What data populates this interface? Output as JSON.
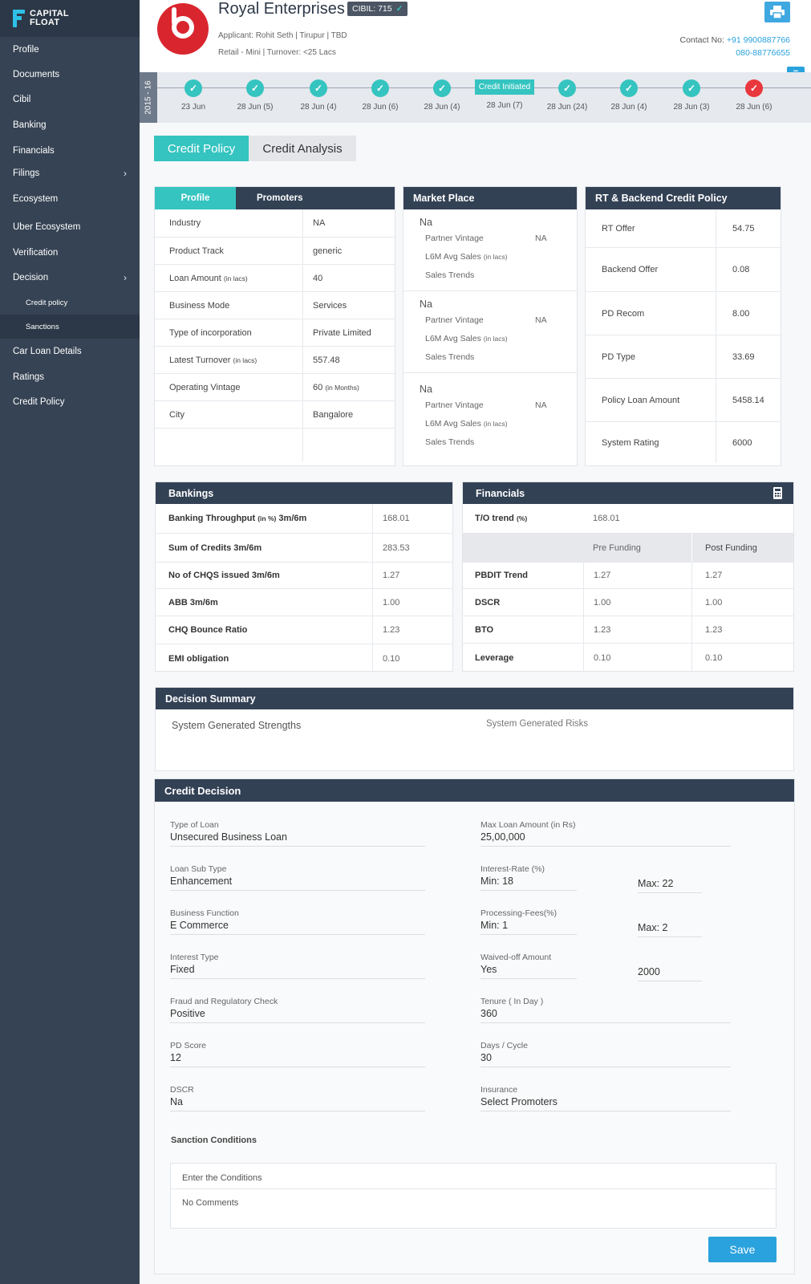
{
  "brand": {
    "line1": "CAPITAL",
    "line2": "FLOAT"
  },
  "sidebar": {
    "items": [
      {
        "label": "Profile"
      },
      {
        "label": "Documents"
      },
      {
        "label": "Cibil"
      },
      {
        "label": "Banking"
      },
      {
        "label": "Financials"
      },
      {
        "label": "Filings",
        "chevron": "›"
      },
      {
        "label": "Ecosystem"
      },
      {
        "label": "Uber Ecosystem"
      },
      {
        "label": "Verification"
      },
      {
        "label": "Decision",
        "chevron": "›"
      },
      {
        "label": "Credit policy"
      },
      {
        "label": "Sanctions"
      },
      {
        "label": "Car Loan Details"
      },
      {
        "label": "Ratings"
      },
      {
        "label": "Credit Policy"
      }
    ]
  },
  "header": {
    "company": "Royal Enterprises",
    "cibil": "CIBIL: 715",
    "cibil_check": "✓",
    "applicant": "Applicant: Rohit Seth | Tirupur | TBD",
    "segment": "Retail - Mini | Turnover: <25 Lacs",
    "contact_label": "Contact No:",
    "phone1": "+91 9900887766",
    "phone2": "080-88776655"
  },
  "timeline": {
    "year": "2015 - 16",
    "collapse": "−",
    "steps": [
      {
        "label": "23 Jun",
        "check": "✓"
      },
      {
        "label": "28 Jun (5)",
        "check": "✓"
      },
      {
        "label": "28 Jun (4)",
        "check": "✓"
      },
      {
        "label": "28 Jun (6)",
        "check": "✓"
      },
      {
        "label": "28 Jun (4)",
        "check": "✓"
      },
      {
        "label": "28 Jun (7)",
        "badge": "Credit Initiated"
      },
      {
        "label": "28 Jun (24)",
        "check": "✓"
      },
      {
        "label": "28 Jun (4)",
        "check": "✓"
      },
      {
        "label": "28 Jun (3)",
        "check": "✓"
      },
      {
        "label": "28 Jun (6)",
        "check": "✓",
        "status": "red"
      }
    ]
  },
  "tabs": {
    "credit_policy": "Credit Policy",
    "credit_analysis": "Credit Analysis"
  },
  "profile": {
    "tab_profile": "Profile",
    "tab_promoters": "Promoters",
    "rows": [
      {
        "k": "Industry",
        "v": "NA"
      },
      {
        "k": "Product Track",
        "v": "generic"
      },
      {
        "k": "Loan Amount",
        "ks": "(in lacs)",
        "v": "40"
      },
      {
        "k": "Business Mode",
        "v": "Services"
      },
      {
        "k": "Type of incorporation",
        "v": "Private Limited"
      },
      {
        "k": "Latest Turnover",
        "ks": "(in lacs)",
        "v": "557.48"
      },
      {
        "k": "Operating Vintage",
        "v": "60",
        "vs": "(in Months)"
      },
      {
        "k": "City",
        "v": "Bangalore"
      }
    ]
  },
  "market": {
    "title": "Market Place",
    "groups": [
      {
        "head": "Na",
        "vintage_label": "Partner Vintage",
        "vintage": "NA",
        "sales_label": "L6M Avg Sales",
        "sales_unit": "(in lacs)",
        "trends": "Sales Trends"
      },
      {
        "head": "Na",
        "vintage_label": "Partner Vintage",
        "vintage": "NA",
        "sales_label": "L6M Avg Sales",
        "sales_unit": "(in lacs)",
        "trends": "Sales Trends"
      },
      {
        "head": "Na",
        "vintage_label": "Partner Vintage",
        "vintage": "NA",
        "sales_label": "L6M Avg Sales",
        "sales_unit": "(in lacs)",
        "trends": "Sales Trends"
      }
    ]
  },
  "rt": {
    "title": "RT & Backend Credit Policy",
    "rows": [
      {
        "k": "RT Offer",
        "v": "54.75"
      },
      {
        "k": "Backend Offer",
        "v": "0.08"
      },
      {
        "k": "PD Recom",
        "v": "8.00"
      },
      {
        "k": "PD Type",
        "v": "33.69"
      },
      {
        "k": "Policy Loan Amount",
        "v": "5458.14"
      },
      {
        "k": "System Rating",
        "v": "6000"
      }
    ]
  },
  "bankings": {
    "title": "Bankings",
    "rows": [
      {
        "k": "Banking Throughput",
        "ks": "(in %)",
        "k2": "3m/6m",
        "v": "168.01"
      },
      {
        "k": "Sum of Credits 3m/6m",
        "v": "283.53"
      },
      {
        "k": "No of CHQS issued 3m/6m",
        "v": "1.27"
      },
      {
        "k": "ABB 3m/6m",
        "v": "1.00"
      },
      {
        "k": "CHQ Bounce Ratio",
        "v": "1.23"
      },
      {
        "k": "EMI obligation",
        "v": "0.10"
      }
    ]
  },
  "financials": {
    "title": "Financials",
    "trend_label": "T/O trend",
    "trend_unit": "(%)",
    "trend_value": "168.01",
    "pre": "Pre Funding",
    "post": "Post Funding",
    "rows": [
      {
        "k": "PBDIT Trend",
        "pre": "1.27",
        "post": "1.27"
      },
      {
        "k": "DSCR",
        "pre": "1.00",
        "post": "1.00"
      },
      {
        "k": "BTO",
        "pre": "1.23",
        "post": "1.23"
      },
      {
        "k": "Leverage",
        "pre": "0.10",
        "post": "0.10"
      }
    ]
  },
  "decision_summary": {
    "title": "Decision Summary",
    "strengths": "System Generated Strengths",
    "risks": "System Generated Risks"
  },
  "credit_decision": {
    "title": "Credit Decision",
    "left": [
      {
        "label": "Type of Loan",
        "value": "Unsecured Business Loan"
      },
      {
        "label": "Loan Sub Type",
        "value": "Enhancement"
      },
      {
        "label": "Business Function",
        "value": "E Commerce"
      },
      {
        "label": "Interest Type",
        "value": "Fixed"
      },
      {
        "label": "Fraud and Regulatory Check",
        "value": "Positive"
      },
      {
        "label": "PD Score",
        "value": "12"
      },
      {
        "label": "DSCR",
        "value": "Na"
      }
    ],
    "max_loan": {
      "label": "Max Loan Amount (in Rs)",
      "value": "25,00,000"
    },
    "interest": {
      "label": "Interest-Rate (%)",
      "min": "Min: 18",
      "max": "Max: 22"
    },
    "fees": {
      "label": "Processing-Fees(%)",
      "min": "Min: 1",
      "max": "Max: 2"
    },
    "waived": {
      "label": "Waived-off Amount",
      "value": "Yes",
      "amount": "2000"
    },
    "tenure": {
      "label": "Tenure ( In Day )",
      "value": "360"
    },
    "days": {
      "label": "Days / Cycle",
      "value": "30"
    },
    "insurance": {
      "label": "Insurance",
      "value": "Select Promoters"
    },
    "sanction_label": "Sanction Conditions",
    "conditions_placeholder": "Enter the Conditions",
    "comments": "No Comments",
    "save": "Save"
  }
}
